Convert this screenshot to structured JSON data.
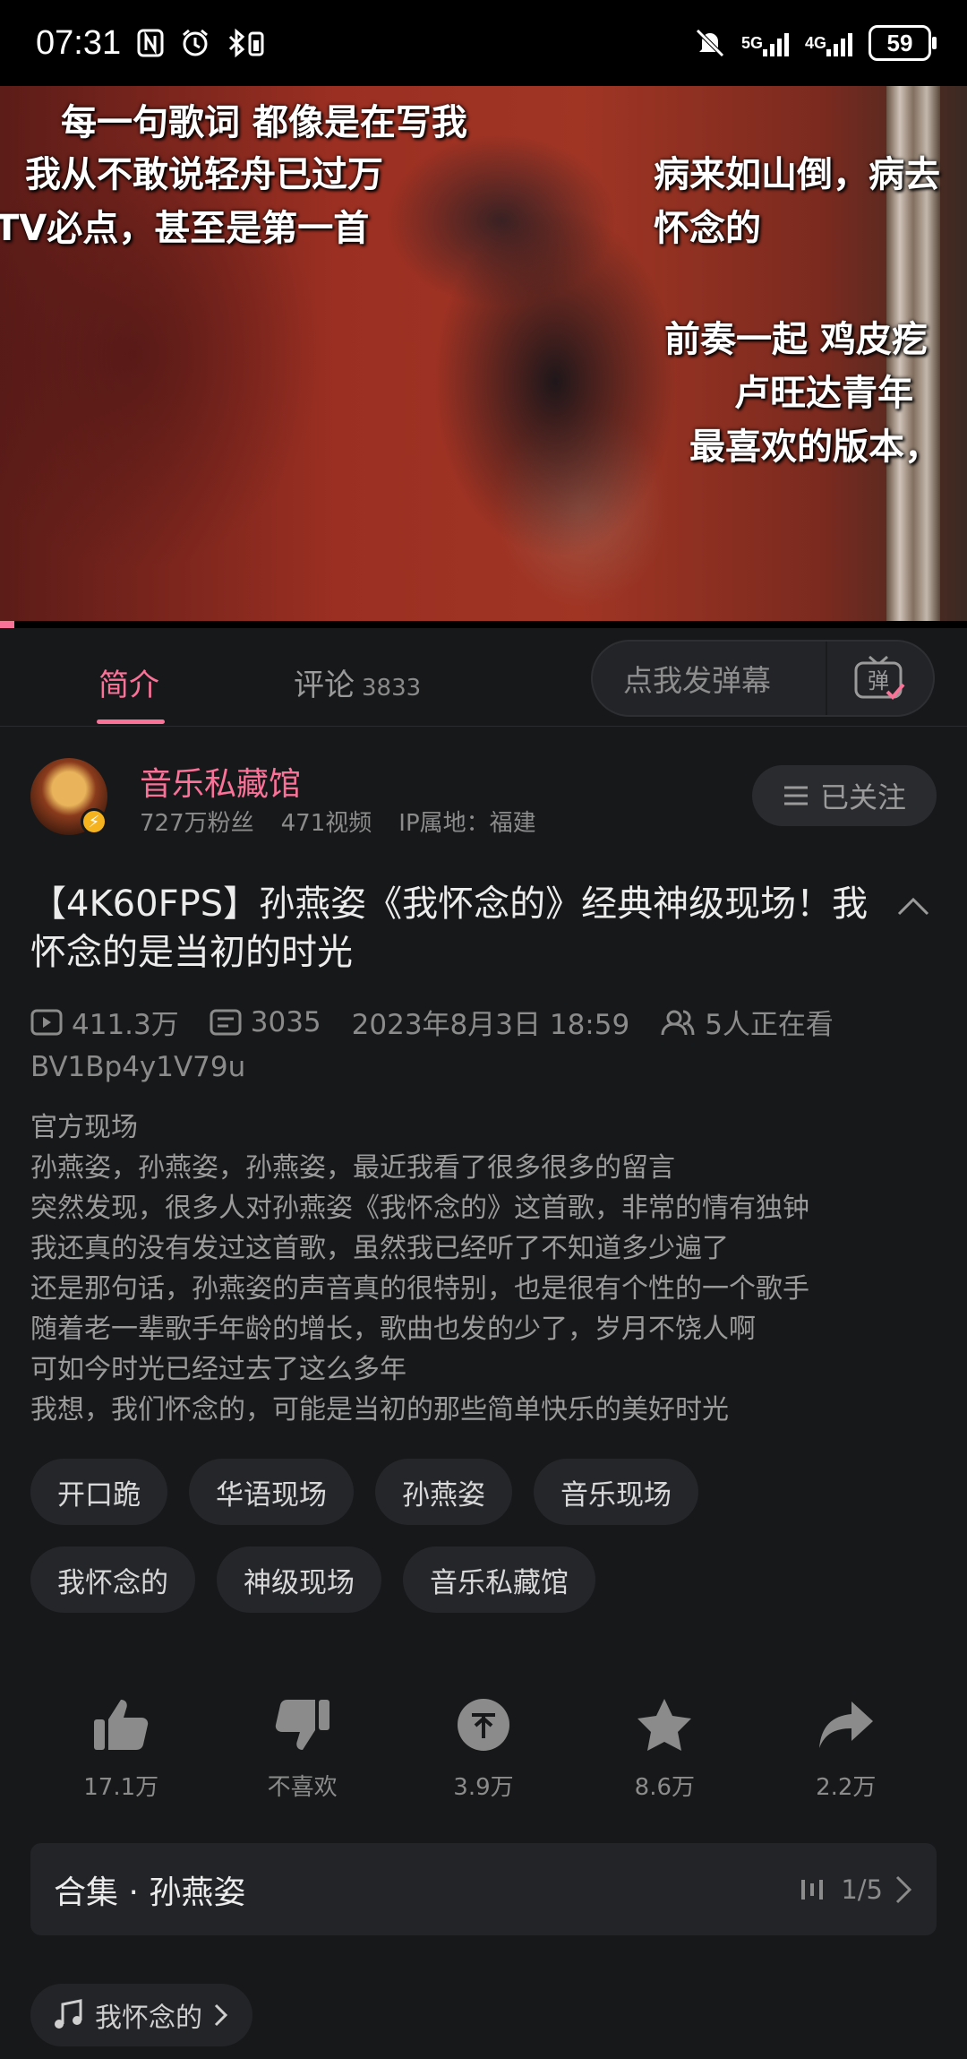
{
  "status_bar": {
    "time": "07:31",
    "left_icons": [
      "nfc-icon",
      "alarm-icon",
      "bluetooth-battery-icon"
    ],
    "network_1": "5G",
    "network_2": "4G",
    "battery": "59"
  },
  "video": {
    "danmaku": [
      "每一句歌词 都像是在写我",
      "我从不敢说轻舟已过万",
      "病来如山倒，病去",
      "TV必点，甚至是第一首",
      "怀念的",
      "前奏一起 鸡皮疙",
      "卢旺达青年",
      "最喜欢的版本，"
    ],
    "progress": 0.015
  },
  "tabs": {
    "intro": "简介",
    "comments": "评论",
    "comments_count": "3833",
    "danmaku_placeholder": "点我发弹幕",
    "danmaku_button": "弹"
  },
  "uploader": {
    "name": "音乐私藏馆",
    "fans": "727万粉丝",
    "videos": "471视频",
    "ip": "IP属地：福建",
    "follow_label": "已关注"
  },
  "video_info": {
    "title": "【4K60FPS】孙燕姿《我怀念的》经典神级现场！我怀念的是当初的时光",
    "views": "411.3万",
    "danmaku_count": "3035",
    "date": "2023年8月3日 18:59",
    "watching": "5人正在看",
    "bvid": "BV1Bp4y1V79u",
    "description": [
      "官方现场",
      "孙燕姿，孙燕姿，孙燕姿，最近我看了很多很多的留言",
      "突然发现，很多人对孙燕姿《我怀念的》这首歌，非常的情有独钟",
      "我还真的没有发过这首歌，虽然我已经听了不知道多少遍了",
      "还是那句话，孙燕姿的声音真的很特别，也是很有个性的一个歌手",
      "随着老一辈歌手年龄的增长，歌曲也发的少了，岁月不饶人啊",
      "可如今时光已经过去了这么多年",
      "我想，我们怀念的，可能是当初的那些简单快乐的美好时光"
    ]
  },
  "tags": [
    "开口跪",
    "华语现场",
    "孙燕姿",
    "音乐现场",
    "我怀念的",
    "神级现场",
    "音乐私藏馆"
  ],
  "actions": {
    "like": "17.1万",
    "dislike": "不喜欢",
    "coin": "3.9万",
    "favorite": "8.6万",
    "share": "2.2万"
  },
  "collection": {
    "title": "合集 · 孙燕姿",
    "progress": "1/5"
  },
  "bgm": {
    "song": "我怀念的"
  },
  "colors": {
    "accent": "#fb7299",
    "background": "#17181a"
  }
}
